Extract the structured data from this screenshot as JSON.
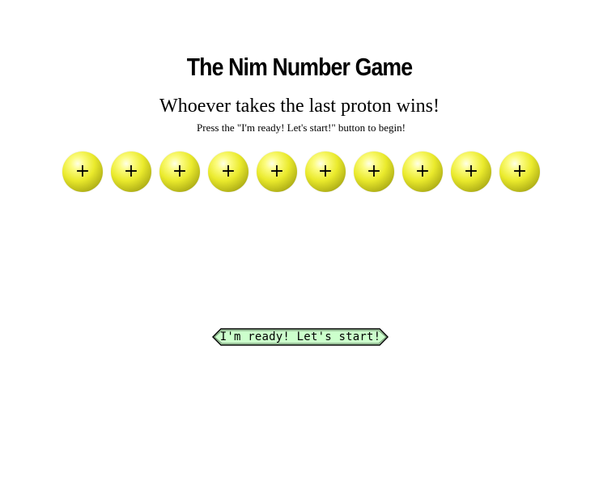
{
  "game": {
    "title": "The Nim Number Game",
    "subtitle": "Whoever takes the last proton wins!",
    "instruction": "Press the \"I'm ready! Let's start!\" button to begin!"
  },
  "protons": {
    "count": 10,
    "symbol": "+",
    "icon": "proton-icon",
    "color": "#eaea2c"
  },
  "start_button": {
    "label": "I'm ready! Let's start!",
    "color": "#ccffcc"
  }
}
